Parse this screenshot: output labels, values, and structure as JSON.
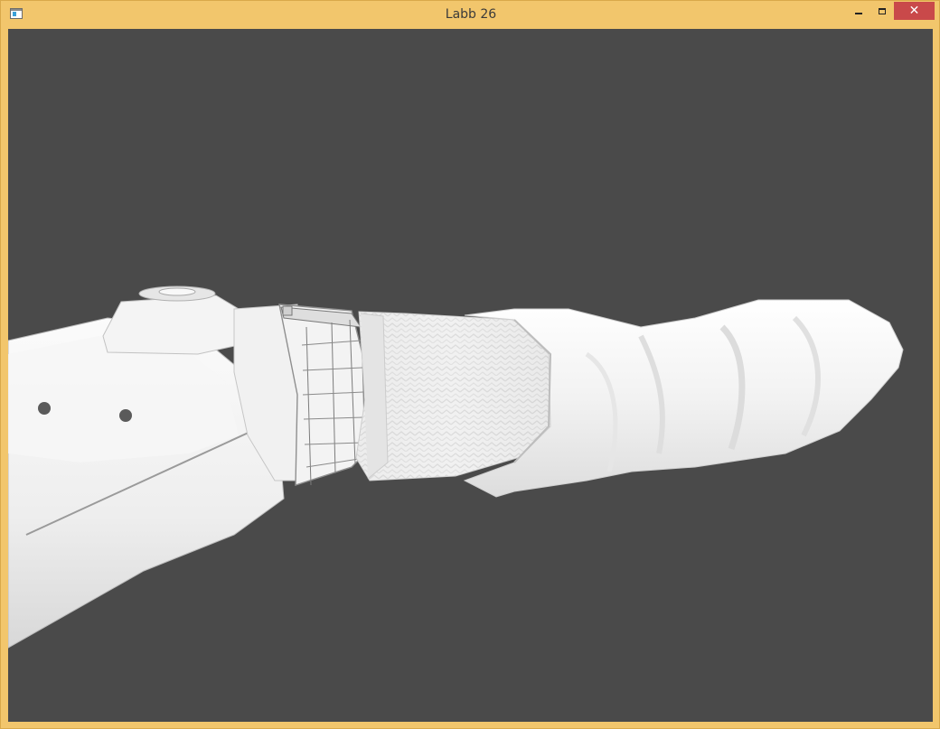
{
  "window": {
    "title": "Labb 26",
    "close_glyph": "✕",
    "icons": {
      "app": "app-window-icon",
      "minimize": "minimize-icon",
      "maximize": "maximize-icon",
      "close": "close-icon"
    },
    "colors": {
      "frame": "#f2c66c",
      "close_button": "#c9494a",
      "viewport_background": "#4a4a4a"
    }
  },
  "scene": {
    "description_objects": [
      "arm",
      "wristwatch",
      "knit-cuff",
      "sleeve"
    ]
  }
}
